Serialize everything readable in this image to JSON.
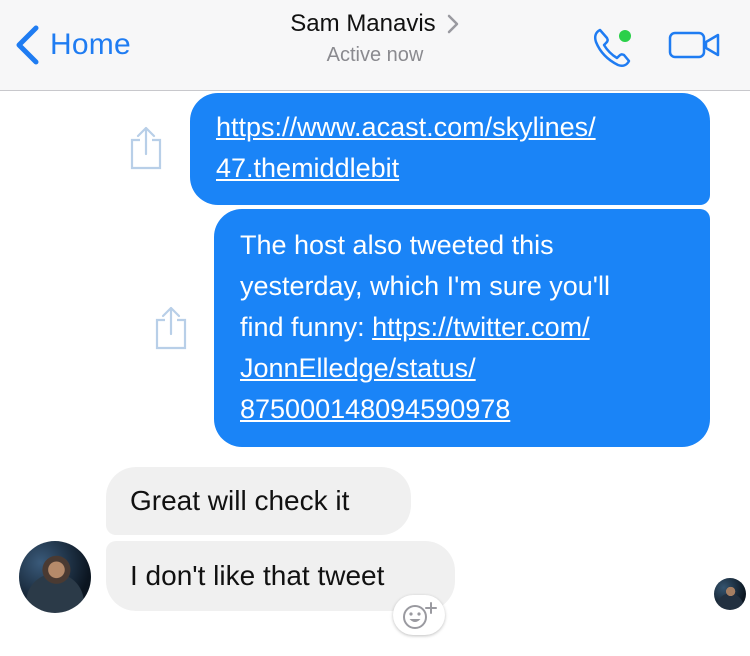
{
  "header": {
    "back_label": "Home",
    "contact_name": "Sam Manavis",
    "status": "Active now"
  },
  "messages": [
    {
      "direction": "outgoing",
      "link": "https://www.acast.com/skylines/47.themiddlebit",
      "line1": "https://www.acast.com/skylines/",
      "line2": "47.themiddlebit"
    },
    {
      "direction": "outgoing",
      "line1": "The host also tweeted this",
      "line2": "yesterday, which I'm sure you'll",
      "line3_text": "find funny: ",
      "line3_link": "https://twitter.com/",
      "line4": "JonnElledge/status/",
      "line5": "875000148094590978"
    },
    {
      "direction": "incoming",
      "text": "Great will check it"
    },
    {
      "direction": "incoming",
      "text": "I don't like that tweet"
    }
  ],
  "colors": {
    "accent": "#1f7cf2",
    "outgoing_bubble": "#1a84f7",
    "incoming_bubble": "#f0f0f0",
    "online_dot": "#2bd04a"
  },
  "icons": [
    "back-chevron-icon",
    "title-chevron-icon",
    "phone-icon",
    "video-camera-icon",
    "share-icon",
    "add-reaction-icon"
  ]
}
